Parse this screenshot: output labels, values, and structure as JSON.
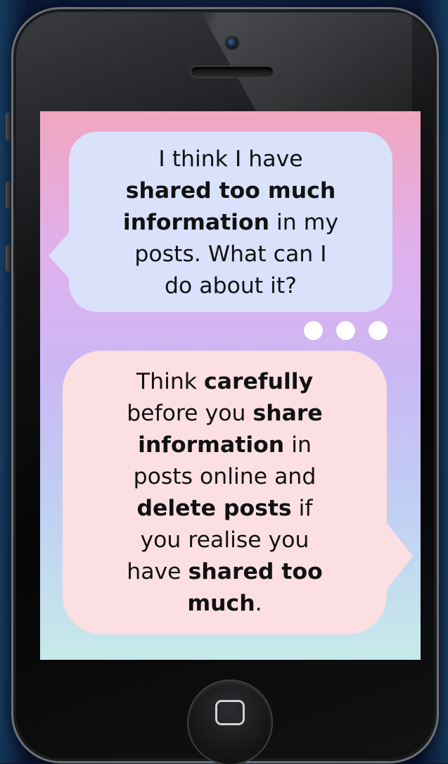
{
  "background": {
    "color": "#0c1c3d"
  },
  "phone": {
    "frame_color": "#121315",
    "screen_gradient": [
      "#f1a6c0",
      "#cab8f4",
      "#c6eaea"
    ]
  },
  "messages": {
    "incoming": {
      "color": "#d9e1fb",
      "line1": "I think I have",
      "bold1": "shared too much",
      "bold2": "information",
      "line2_rest": " in my",
      "line3": "posts. What can I",
      "line4": "do about it?"
    },
    "typing_indicator": {
      "dots": 3,
      "color": "#ffffff"
    },
    "reply": {
      "color": "#fbdfe3",
      "t1": "Think ",
      "b1": "carefully",
      "t2": "before you ",
      "b2": "share",
      "b3": "information",
      "t3": " in",
      "t4": "posts online and",
      "b4": "delete posts",
      "t5": " if",
      "t6": "you realise you",
      "t7": "have ",
      "b5": "shared too",
      "b6": "much",
      "t8": "."
    }
  },
  "icons": {
    "camera": "camera-icon",
    "speaker": "speaker-icon",
    "home": "home-button-icon"
  }
}
